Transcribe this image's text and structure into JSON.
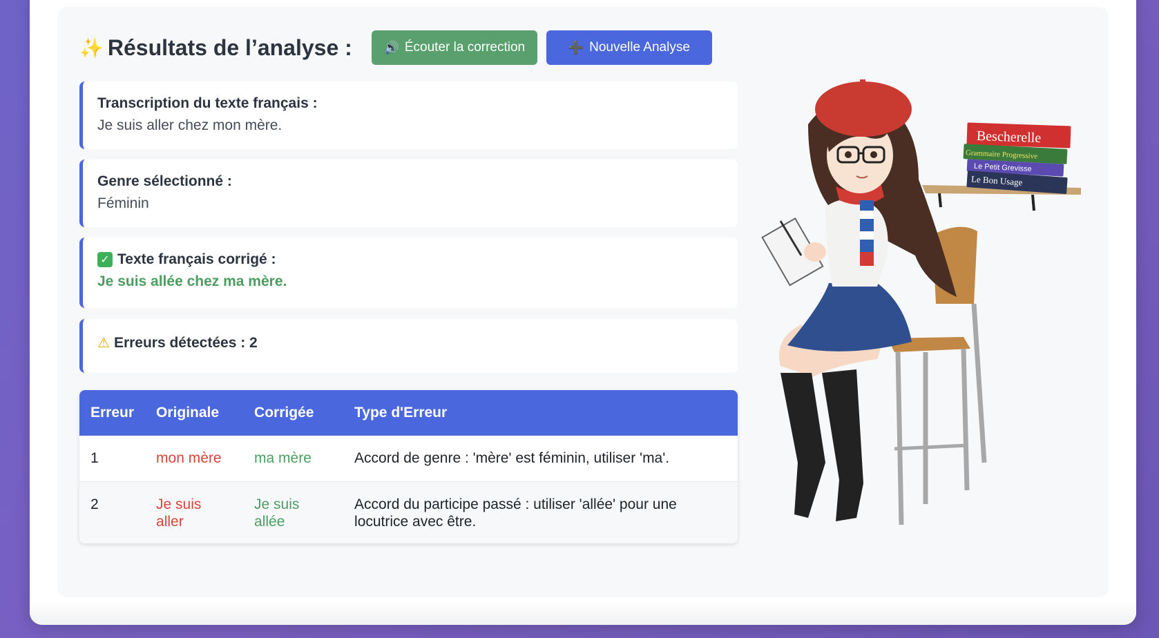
{
  "header": {
    "sparkle_icon": "sparkles-icon",
    "title": "Résultats de l’analyse :",
    "listen_label": "Écouter la correction",
    "listen_icon": "speaker-icon",
    "new_label": "Nouvelle Analyse",
    "new_icon": "plus-icon"
  },
  "transcription": {
    "label": "Transcription du texte français :",
    "value": "Je suis aller chez mon mère."
  },
  "gender": {
    "label": "Genre sélectionné :",
    "value": "Féminin"
  },
  "corrected": {
    "label": "Texte français corrigé :",
    "value": "Je suis allée chez ma mère."
  },
  "errors_summary": {
    "label": "Erreurs détectées : 2"
  },
  "table": {
    "headers": [
      "Erreur",
      "Originale",
      "Corrigée",
      "Type d'Erreur"
    ],
    "rows": [
      {
        "n": "1",
        "original": "mon mère",
        "corrected": "ma mère",
        "type": "Accord de genre : 'mère' est féminin, utiliser 'ma'."
      },
      {
        "n": "2",
        "original": "Je suis aller",
        "corrected": "Je suis allée",
        "type": "Accord du participe passé : utiliser 'allée' pour une locutrice avec être."
      }
    ]
  },
  "books": [
    "Bescherelle",
    "Grammaire Progressive",
    "Le Petit Grevisse",
    "Le Bon Usage"
  ],
  "colors": {
    "accent": "#4a67de",
    "success": "#5aa06e",
    "error": "#d9443d",
    "correct_text": "#4d9d62"
  }
}
